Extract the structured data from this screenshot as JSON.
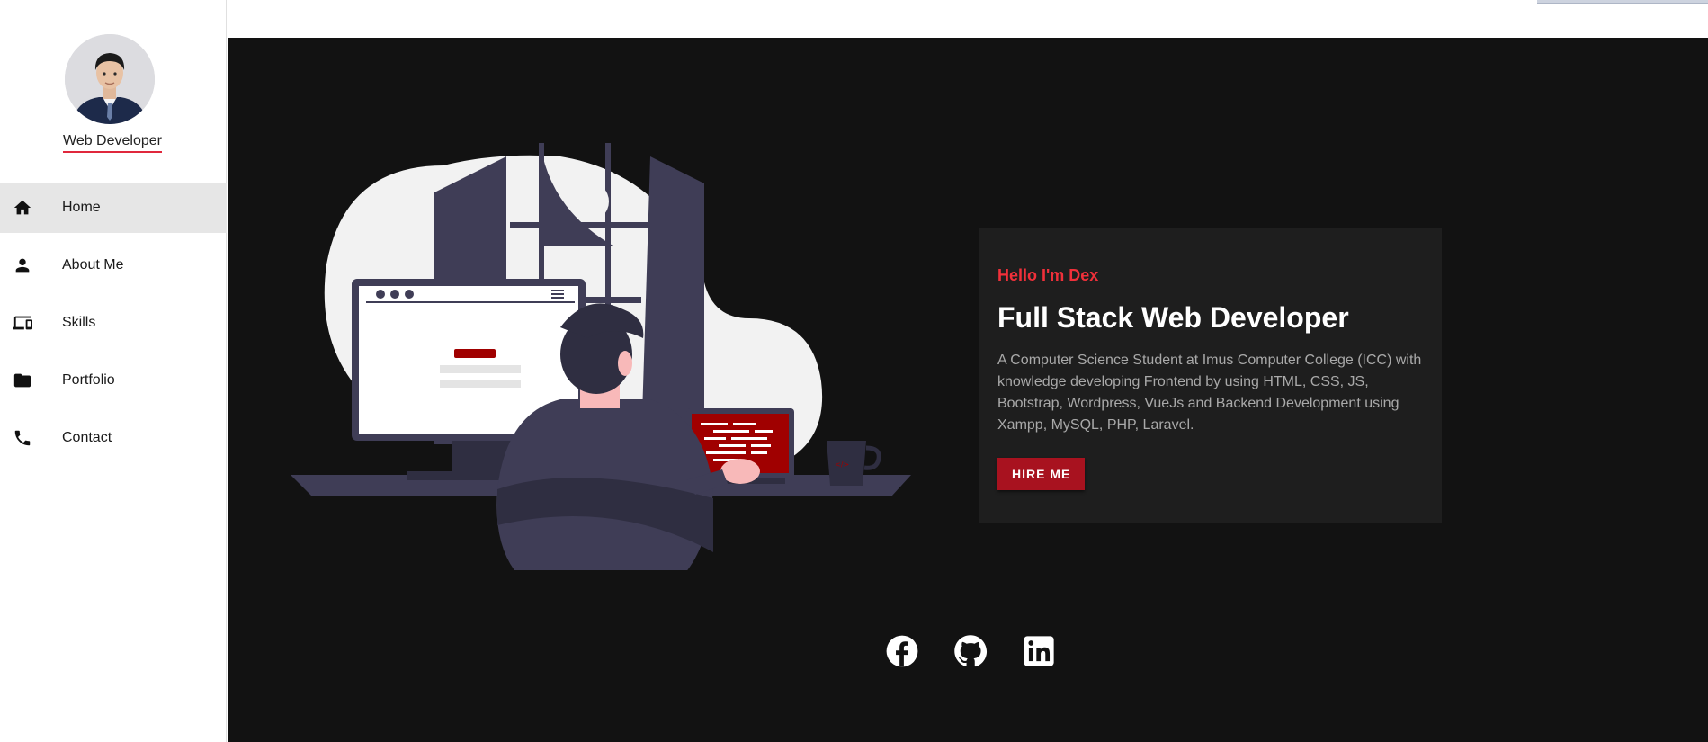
{
  "sidebar": {
    "role": "Web Developer",
    "items": [
      {
        "label": "Home",
        "icon": "home-icon",
        "active": true
      },
      {
        "label": "About Me",
        "icon": "person-icon"
      },
      {
        "label": "Skills",
        "icon": "devices-icon"
      },
      {
        "label": "Portfolio",
        "icon": "folder-icon"
      },
      {
        "label": "Contact",
        "icon": "phone-icon"
      }
    ]
  },
  "hero": {
    "greeting": "Hello I'm Dex",
    "title": "Full Stack Web Developer",
    "description": "A Computer Science Student at Imus Computer College (ICC) with knowledge developing Frontend by using HTML, CSS, JS, Bootstrap, Wordpress, VueJs and Backend Development using Xampp, MySQL, PHP, Laravel.",
    "cta_label": "HIRE ME"
  },
  "socials": [
    {
      "icon": "facebook-icon"
    },
    {
      "icon": "github-icon"
    },
    {
      "icon": "linkedin-icon"
    }
  ],
  "colors": {
    "accent": "#a8121f",
    "greeting": "#f0303a",
    "hero_bg": "#121212",
    "card_bg": "#1e1e1e"
  }
}
